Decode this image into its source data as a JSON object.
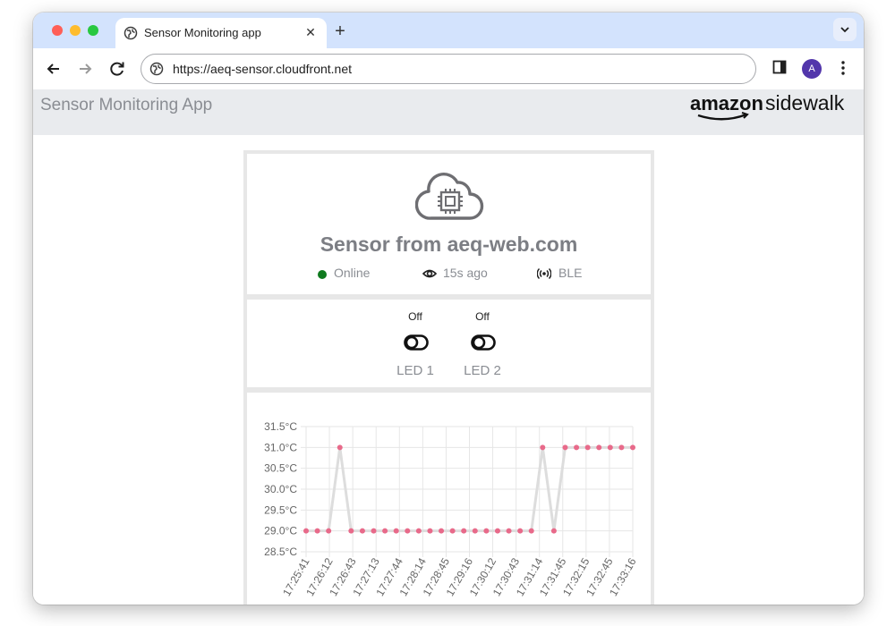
{
  "browser": {
    "tab_title": "Sensor Monitoring app",
    "close_glyph": "✕",
    "new_tab_glyph": "+",
    "url": "https://aeq-sensor.cloudfront.net",
    "profile_initial": "A"
  },
  "app": {
    "title": "Sensor Monitoring App",
    "logo_text_1": "amazon",
    "logo_text_2": "sidewalk"
  },
  "sensor": {
    "name": "Sensor from aeq-web.com",
    "status": "Online",
    "last_seen": "15s ago",
    "link": "BLE",
    "status_color": "#0f7a1e"
  },
  "leds": [
    {
      "label": "LED 1",
      "state": "Off"
    },
    {
      "label": "LED 2",
      "state": "Off"
    }
  ],
  "chart_data": {
    "type": "line",
    "title": "",
    "xlabel": "",
    "ylabel": "",
    "y_unit": "°C",
    "ylim": [
      28.5,
      31.5
    ],
    "y_ticks": [
      "28.5°C",
      "29.0°C",
      "29.5°C",
      "30.0°C",
      "30.5°C",
      "31.0°C",
      "31.5°C"
    ],
    "x_tick_labels": [
      "17:25:41",
      "17:26:12",
      "17:26:43",
      "17:27:13",
      "17:27:44",
      "17:28:14",
      "17:28:45",
      "17:29:16",
      "17:30:12",
      "17:30:43",
      "17:31:14",
      "17:31:45",
      "17:32:15",
      "17:32:45",
      "17:33:16"
    ],
    "series": [
      {
        "values": [
          29.0,
          29.0,
          29.0,
          31.0,
          29.0,
          29.0,
          29.0,
          29.0,
          29.0,
          29.0,
          29.0,
          29.0,
          29.0,
          29.0,
          29.0,
          29.0,
          29.0,
          29.0,
          29.0,
          29.0,
          29.0,
          31.0,
          29.0,
          31.0,
          31.0,
          31.0,
          31.0,
          31.0,
          31.0,
          31.0
        ],
        "point_color": "#e86a8a",
        "line_color": "#dddddd"
      }
    ],
    "grid": true
  }
}
